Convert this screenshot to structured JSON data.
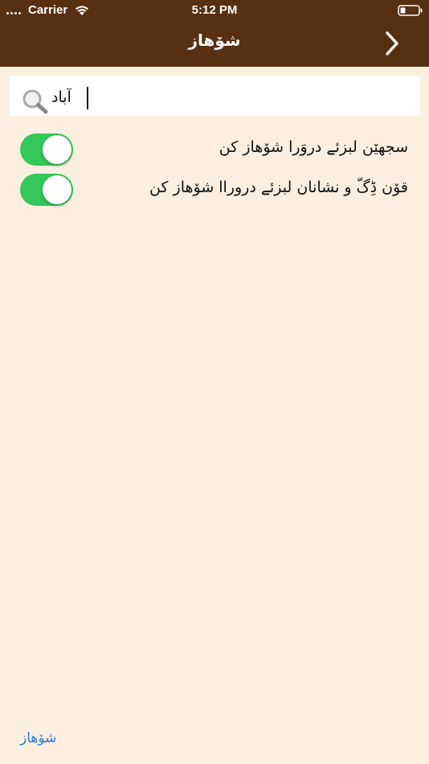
{
  "status_bar": {
    "carrier": "Carrier",
    "time": "5:12 PM",
    "wifi_icon": "wifi-icon",
    "battery_icon": "battery-icon",
    "signal_icon": "signal-dots-icon"
  },
  "nav": {
    "title": "شۆهاز",
    "back_icon": "chevron-right-icon"
  },
  "search": {
    "value": "آباد",
    "icon": "search-icon"
  },
  "options": [
    {
      "label": "سجهێن لبزئے دروَرا شۆهاز کن",
      "enabled": true
    },
    {
      "label": "قۆن ڈِگّ و نشانان لبزئے دروراا شۆهاز کن",
      "enabled": true
    }
  ],
  "footer": {
    "link_label": "شۆهاز"
  },
  "colors": {
    "header": "#572f12",
    "background": "#fcefdf",
    "toggle_on": "#34c759",
    "link": "#2b7ad9"
  }
}
